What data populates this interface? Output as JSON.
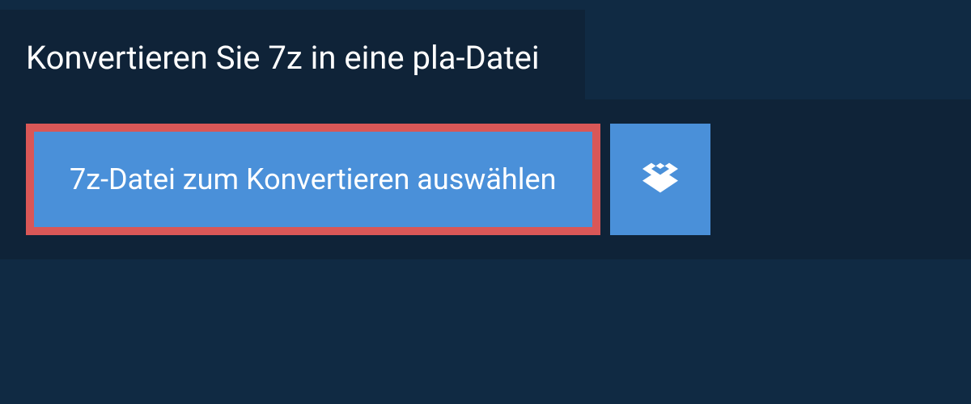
{
  "header": {
    "title": "Konvertieren Sie 7z in eine pla-Datei"
  },
  "actions": {
    "select_file_label": "7z-Datei zum Konvertieren auswählen"
  },
  "colors": {
    "background": "#102a43",
    "panel": "#0f2338",
    "button_bg": "#4a90d9",
    "highlight_border": "#d95757",
    "text": "#ffffff"
  }
}
